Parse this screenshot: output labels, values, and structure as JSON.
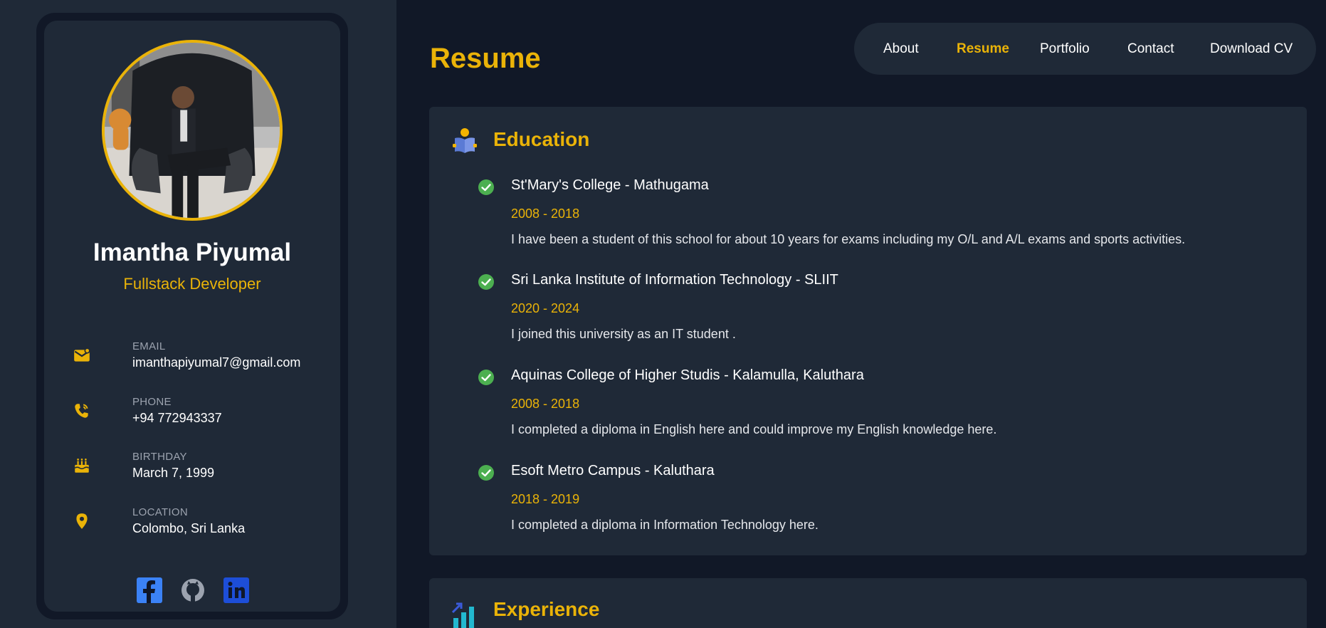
{
  "profile": {
    "name": "Imantha Piyumal",
    "role": "Fullstack Developer",
    "contacts": {
      "email": {
        "label": "EMAIL",
        "value": "imanthapiyumal7@gmail.com",
        "icon": "mail-icon"
      },
      "phone": {
        "label": "PHONE",
        "value": "+94 772943337",
        "icon": "phone-icon"
      },
      "birthday": {
        "label": "BIRTHDAY",
        "value": "March 7, 1999",
        "icon": "cake-icon"
      },
      "location": {
        "label": "LOCATION",
        "value": "Colombo, Sri Lanka",
        "icon": "location-pin-icon"
      }
    },
    "social": [
      "facebook-icon",
      "github-icon",
      "linkedin-icon"
    ]
  },
  "header": {
    "title": "Resume"
  },
  "nav": {
    "items": [
      {
        "label": "About",
        "active": false
      },
      {
        "label": "Resume",
        "active": true
      },
      {
        "label": "Portfolio",
        "active": false
      },
      {
        "label": "Contact",
        "active": false
      },
      {
        "label": "Download CV",
        "active": false
      }
    ]
  },
  "education": {
    "title": "Education",
    "icon": "reader-book-icon",
    "entries": [
      {
        "title": "St'Mary's College - Mathugama",
        "years": "2008 - 2018",
        "description": "I have been a student of this school for about 10 years for exams including my O/L and A/L exams and sports activities."
      },
      {
        "title": "Sri Lanka Institute of Information Technology - SLIIT",
        "years": "2020 - 2024",
        "description": "I joined this university as an IT student ."
      },
      {
        "title": "Aquinas College of Higher Studis - Kalamulla, Kaluthara",
        "years": "2008 - 2018",
        "description": "I completed a diploma in English here and could improve my English knowledge here."
      },
      {
        "title": "Esoft Metro Campus - Kaluthara",
        "years": "2018 - 2019",
        "description": "I completed a diploma in Information Technology here."
      }
    ]
  },
  "experience": {
    "title": "Experience",
    "icon": "growth-chart-icon"
  },
  "colors": {
    "accent": "#eab308",
    "background": "#111827",
    "card": "#1f2937",
    "check": "#4caf50"
  }
}
